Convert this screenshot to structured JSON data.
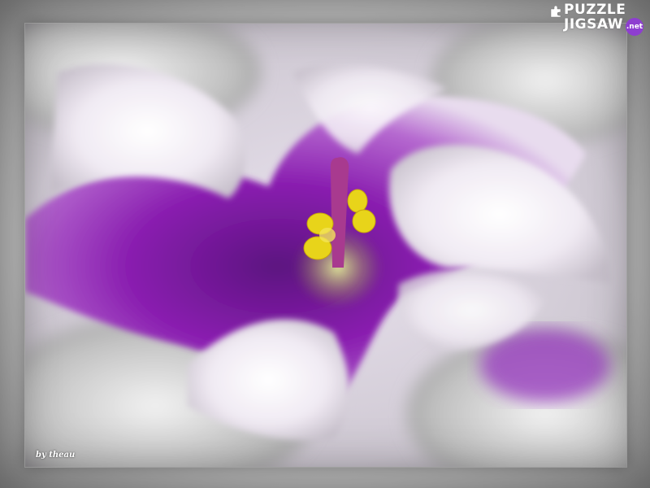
{
  "watermark": {
    "line1": "PUZZLE",
    "line2": "JIGSAW",
    "badge": ".net",
    "badge_color": "#8e3ed0",
    "icon": "puzzle-piece-icon"
  },
  "signature": "by theau",
  "colors": {
    "petal_white": "#f4f0f6",
    "petal_purple": "#8a1fb0",
    "deep_purple": "#5c1280",
    "stamen_yellow": "#e8d41a",
    "frame_gray": "#cfcfcf"
  }
}
